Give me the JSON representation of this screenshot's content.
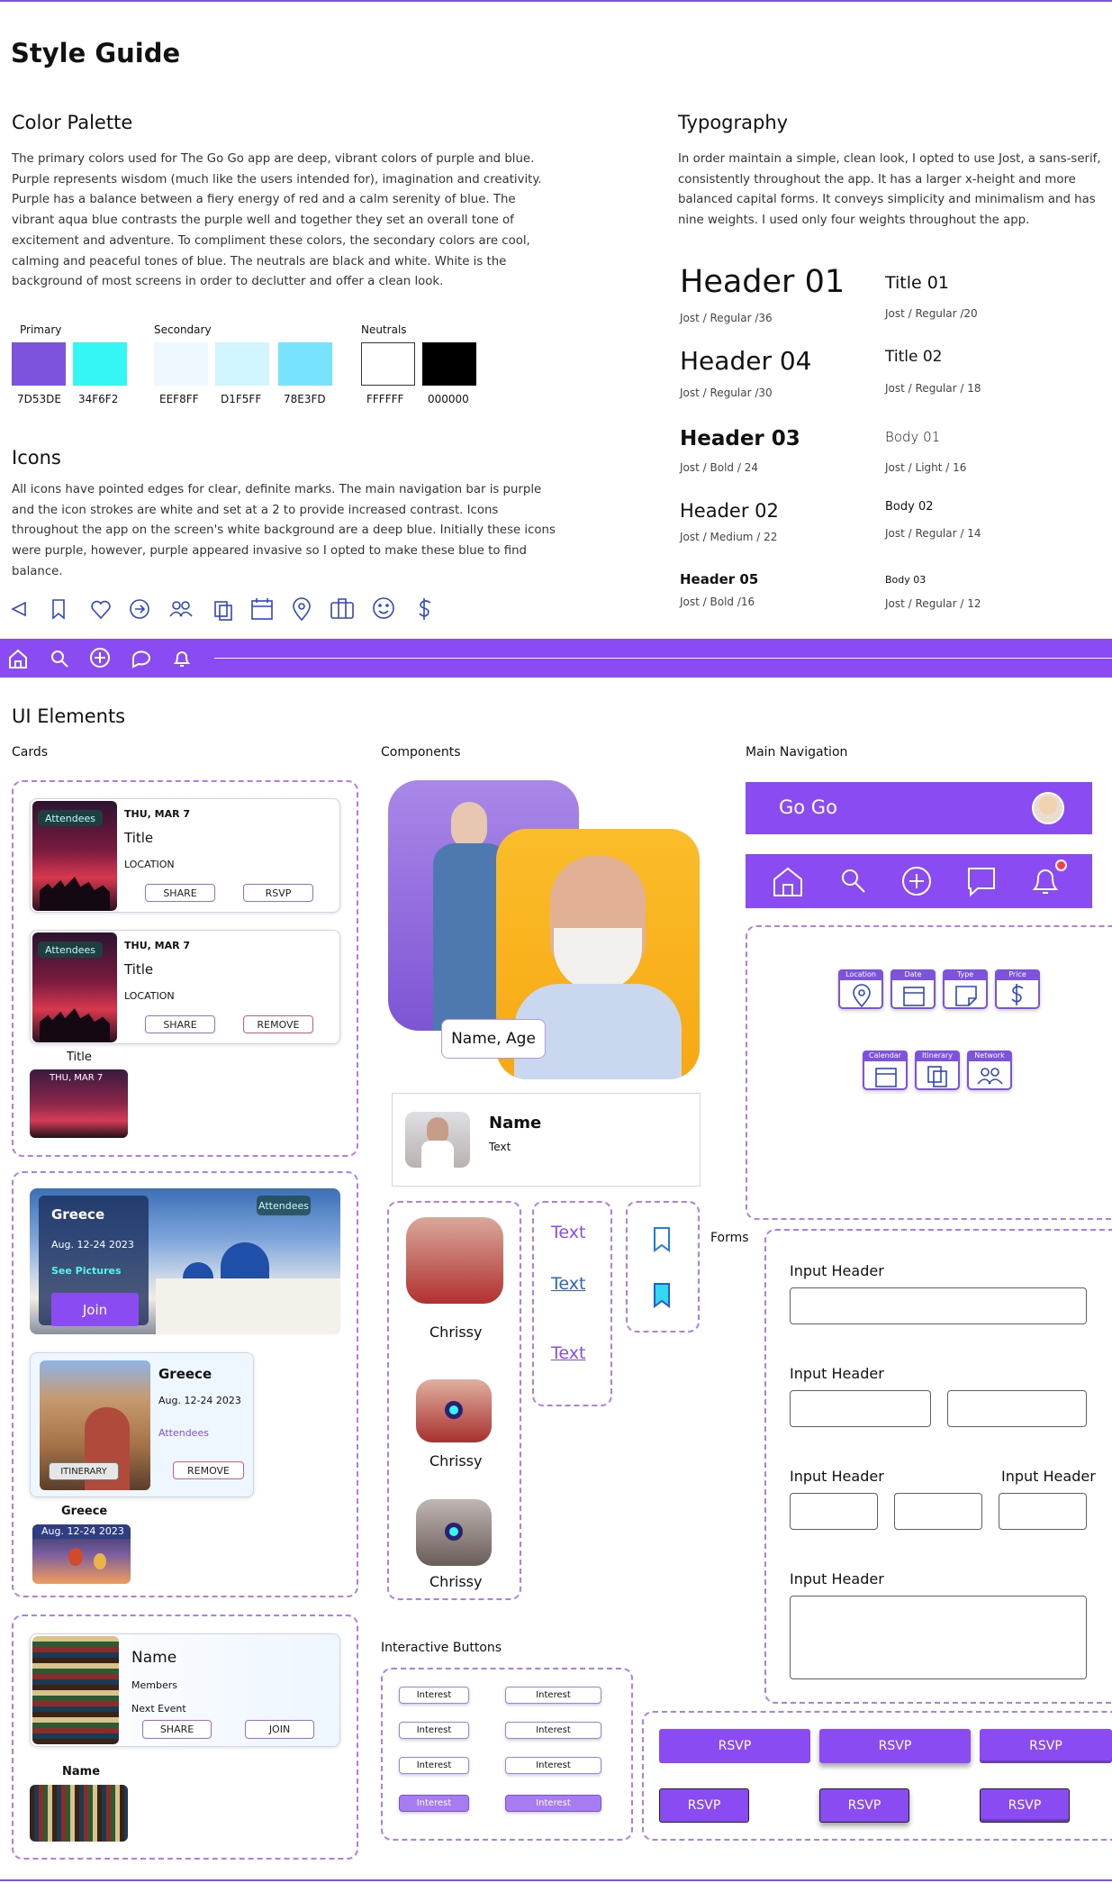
{
  "title": "Style Guide",
  "color_palette": {
    "heading": "Color Palette",
    "body": "The primary colors used for The Go Go app are deep, vibrant colors of purple and blue. Purple represents wisdom (much like the users intended for), imagination and creativity. Purple has a balance between a fiery energy of red and a calm serenity of blue. The vibrant aqua blue contrasts the purple well and together they set an overall tone of excitement and adventure. To compliment these colors, the secondary colors are cool, calming and peaceful tones of blue. The neutrals are black and white. White is the background of most screens in order to declutter and offer a clean look.",
    "groups": {
      "primary": "Primary",
      "secondary": "Secondary",
      "neutrals": "Neutrals"
    },
    "swatches": [
      {
        "hex": "#7D53DE",
        "label": "7D53DE"
      },
      {
        "hex": "#34F6F2",
        "label": "34F6F2"
      },
      {
        "hex": "#EEF8FF",
        "label": "EEF8FF"
      },
      {
        "hex": "#D1F5FF",
        "label": "D1F5FF"
      },
      {
        "hex": "#78E3FD",
        "label": "78E3FD"
      },
      {
        "hex": "#FFFFFF",
        "label": "FFFFFF"
      },
      {
        "hex": "#000000",
        "label": "000000"
      }
    ]
  },
  "typography": {
    "heading": "Typography",
    "body": "In order maintain a simple, clean look, I opted to use Jost, a sans-serif, consistently throughout the app. It has a larger x-height and more balanced capital forms. It conveys simplicity and minimalism and has nine weights. I used only four weights throughout the app.",
    "samples": [
      {
        "name": "Header 01",
        "spec": "Jost / Regular /36"
      },
      {
        "name": "Header 04",
        "spec": "Jost / Regular /30"
      },
      {
        "name": "Header 03",
        "spec": "Jost / Bold / 24"
      },
      {
        "name": "Header 02",
        "spec": "Jost / Medium / 22"
      },
      {
        "name": "Header 05",
        "spec": "Jost / Bold /16"
      },
      {
        "name": "Title 01",
        "spec": "Jost / Regular /20"
      },
      {
        "name": "Title 02",
        "spec": "Jost / Regular / 18"
      },
      {
        "name": "Body 01",
        "spec": "Jost / Light / 16"
      },
      {
        "name": "Body 02",
        "spec": "Jost / Regular / 14"
      },
      {
        "name": "Body 03",
        "spec": "Jost / Regular / 12"
      }
    ]
  },
  "icons": {
    "heading": "Icons",
    "body": "All icons have pointed edges for clear, definite marks. The main navigation bar is purple and the icon strokes are white and set at a 2 to provide increased contrast. Icons throughout the app on the screen's white background are a deep blue. Initially these icons were purple, however, purple appeared invasive so I opted to make these blue to find balance.",
    "set": [
      "back-arrow",
      "bookmark",
      "heart",
      "arrow-circle",
      "people",
      "copy",
      "calendar",
      "location-pin",
      "briefcase",
      "smile",
      "dollar"
    ]
  },
  "colors": {
    "primary": "#7D53DE",
    "bar": "#8A4CF2",
    "icon_blue": "#3046C8",
    "dash": "#B27CF0",
    "red": "#E2576B",
    "aqua": "#34F6F2"
  },
  "ui": {
    "heading": "UI Elements",
    "cards_label": "Cards",
    "components_label": "Components",
    "main_nav_label": "Main Navigation",
    "forms_label": "Forms",
    "interactive_label": "Interactive Buttons"
  },
  "event_cards": {
    "attendees": "Attendees",
    "date": "THU, MAR 7",
    "title": "Title",
    "location": "LOCATION",
    "share": "SHARE",
    "rsvp": "RSVP",
    "remove": "REMOVE",
    "mini_title": "Title",
    "mini_date": "THU, MAR 7"
  },
  "trip_cards": {
    "place": "Greece",
    "dates": "Aug. 12-24 2023",
    "see_pictures": "See Pictures",
    "join": "Join",
    "attendees": "Attendees",
    "itinerary": "ITINERARY",
    "remove": "REMOVE",
    "mini_place": "Greece",
    "mini_dates": "Aug. 12-24 2023"
  },
  "group_card": {
    "name": "Name",
    "members": "Members",
    "next_event": "Next Event",
    "share": "SHARE",
    "join": "JOIN",
    "mini_name": "Name"
  },
  "components": {
    "name_age": "Name, Age",
    "profile_name": "Name",
    "profile_text": "Text",
    "avatars": [
      "Chrissy",
      "Chrissy",
      "Chrissy"
    ],
    "text_links": [
      "Text",
      "Text",
      "Text"
    ]
  },
  "main_nav": {
    "brand": "Go Go"
  },
  "filters": {
    "row1": [
      "Location",
      "Date",
      "Type",
      "Price"
    ],
    "row2": [
      "Calendar",
      "Itinerary",
      "Network"
    ]
  },
  "forms": {
    "input_header": "Input Header"
  },
  "interactive": {
    "label": "Interest"
  },
  "rsvp": {
    "label": "RSVP"
  }
}
